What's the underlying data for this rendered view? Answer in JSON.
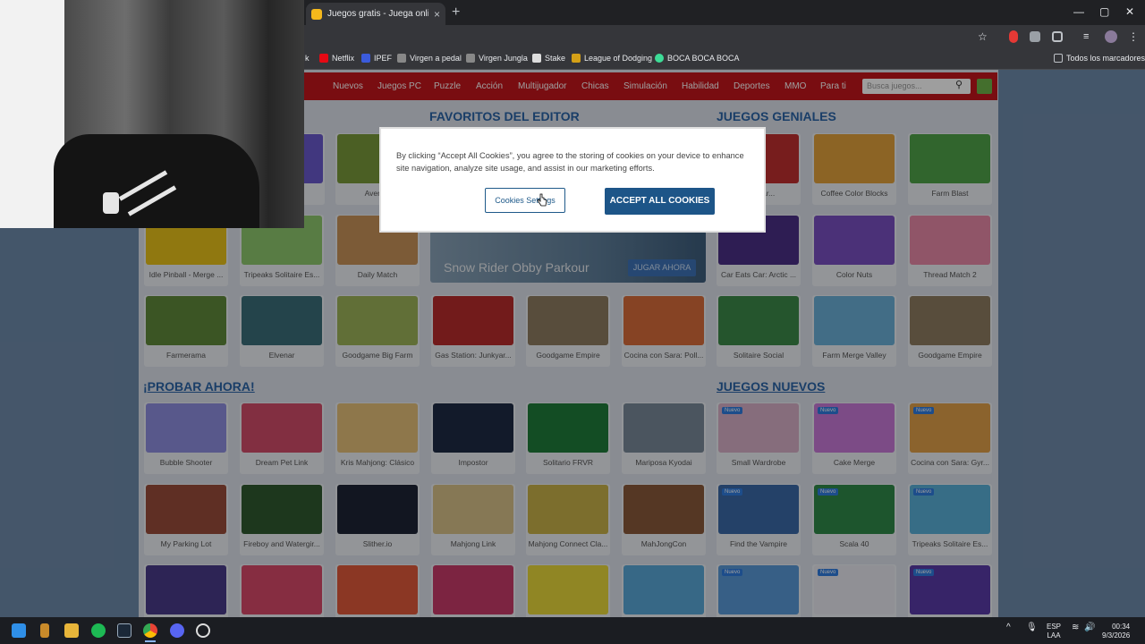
{
  "browser": {
    "tab_title": "Juegos gratis - Juega online en",
    "tab_close": "×",
    "new_tab": "+",
    "window_controls": [
      "—",
      "▢",
      "✕"
    ],
    "bookmarks": [
      {
        "label": "k",
        "color": "#aaaaaa"
      },
      {
        "label": "Netflix",
        "color": "#e50914"
      },
      {
        "label": "IPEF",
        "color": "#3b5bdb"
      },
      {
        "label": "Virgen a pedal",
        "color": "#888888"
      },
      {
        "label": "Virgen Jungla",
        "color": "#888888"
      },
      {
        "label": "Stake",
        "color": "#dddddd"
      },
      {
        "label": "League of Dodging",
        "color": "#d4a017"
      },
      {
        "label": "BOCA BOCA BOCA",
        "color": "#3ddc97"
      }
    ],
    "all_bookmarks": "Todos los marcadores"
  },
  "site": {
    "nav": [
      "Nuevos",
      "Juegos PC",
      "Puzzle",
      "Acción",
      "Multijugador",
      "Chicas",
      "Simulación",
      "Habilidad",
      "Deportes",
      "MMO",
      "Para ti"
    ],
    "search_placeholder": "Busca juegos...",
    "sections": {
      "favoritos": "FAVORITOS DEL EDITOR",
      "geniales": "JUEGOS GENIALES",
      "probar": "¡PROBAR AHORA!",
      "nuevos": "JUEGOS NUEVOS"
    },
    "featured": {
      "title": "Snow Rider Obby Parkour",
      "button": "JUGAR AHORA"
    },
    "new_badge": "Nuevo",
    "left_cards_row1": [
      {
        "label": "",
        "color": "#6a5acd"
      },
      {
        "label": "Avenge",
        "color": "#7a9a3a"
      }
    ],
    "left_cards_row2": [
      {
        "label": "Idle Pinball - Merge ...",
        "color": "#e8c21a"
      },
      {
        "label": "Tripeaks Solitaire Es...",
        "color": "#8fc86e"
      },
      {
        "label": "Daily Match",
        "color": "#c9935a"
      }
    ],
    "row3": [
      {
        "label": "Farmerama",
        "color": "#5f8a3a"
      },
      {
        "label": "Elvenar",
        "color": "#3b6e7a"
      },
      {
        "label": "Goodgame Big Farm",
        "color": "#9db35a"
      },
      {
        "label": "Gas Station: Junkyar...",
        "color": "#b82c2c"
      },
      {
        "label": "Goodgame Empire",
        "color": "#8e7d62"
      },
      {
        "label": "Cocina con Sara: Poll...",
        "color": "#d86d3a"
      }
    ],
    "geniales_row1": [
      {
        "label": "Junkyar...",
        "color": "#c03030"
      },
      {
        "label": "Coffee Color Blocks",
        "color": "#e3a23c"
      },
      {
        "label": "Farm Blast",
        "color": "#4fa34a"
      }
    ],
    "geniales_row2": [
      {
        "label": "Car Eats Car: Arctic ...",
        "color": "#4b2f86"
      },
      {
        "label": "Color Nuts",
        "color": "#7a4fc2"
      },
      {
        "label": "Thread Match 2",
        "color": "#e88aa8"
      }
    ],
    "geniales_row3": [
      {
        "label": "Solitaire Social",
        "color": "#3d8a4a"
      },
      {
        "label": "Farm Merge Valley",
        "color": "#6bb0d8"
      },
      {
        "label": "Goodgame Empire",
        "color": "#8e7d62"
      }
    ],
    "probar_row1": [
      {
        "label": "Bubble Shooter",
        "color": "#8f8fe0"
      },
      {
        "label": "Dream Pet Link",
        "color": "#d24c6a"
      },
      {
        "label": "Kris Mahjong: Clásico",
        "color": "#e6c07a"
      },
      {
        "label": "Impostor",
        "color": "#1e2a44"
      },
      {
        "label": "Solitario FRVR",
        "color": "#1f7d3a"
      },
      {
        "label": "Mariposa Kyodai",
        "color": "#7a8a9a"
      }
    ],
    "probar_row2": [
      {
        "label": "My Parking Lot",
        "color": "#9a4c3a"
      },
      {
        "label": "Fireboy and Watergir...",
        "color": "#2f5a2f"
      },
      {
        "label": "Slither.io",
        "color": "#1d2436"
      },
      {
        "label": "Mahjong Link",
        "color": "#d8c28a"
      },
      {
        "label": "Mahjong Connect Cla...",
        "color": "#c8b24a"
      },
      {
        "label": "MahJongCon",
        "color": "#8a5a3a"
      }
    ],
    "probar_row3": [
      {
        "label": "",
        "color": "#4a3a8a"
      },
      {
        "label": "",
        "color": "#d84a6a"
      },
      {
        "label": "",
        "color": "#e05a3a"
      },
      {
        "label": "",
        "color": "#c83a6a"
      },
      {
        "label": "",
        "color": "#e8d83a"
      },
      {
        "label": "",
        "color": "#5aa8d8"
      }
    ],
    "nuevos_row1": [
      {
        "label": "Small Wardrobe",
        "color": "#d8b0c8"
      },
      {
        "label": "Cake Merge",
        "color": "#c87ad8"
      },
      {
        "label": "Cocina con Sara: Gyr...",
        "color": "#e0a04a"
      }
    ],
    "nuevos_row2": [
      {
        "label": "Find the Vampire",
        "color": "#3a6aa8"
      },
      {
        "label": "Scala 40",
        "color": "#2f8a4a"
      },
      {
        "label": "Tripeaks Solitaire Es...",
        "color": "#5ab0d8"
      }
    ],
    "nuevos_row3": [
      {
        "label": "",
        "color": "#5a9ad8"
      },
      {
        "label": "",
        "color": "#e8e8f0"
      },
      {
        "label": "",
        "color": "#5a3aa8"
      }
    ]
  },
  "cookie_modal": {
    "text": "By clicking “Accept All Cookies”, you agree to the storing of cookies on your device to enhance site navigation, analyze site usage, and assist in our marketing efforts.",
    "settings_button": "Cookies Settings",
    "accept_button": "ACCEPT ALL COOKIES"
  },
  "taskbar": {
    "lang": "ESP",
    "layout": "LAA",
    "time": "00:34",
    "date": "9/3/2026"
  }
}
